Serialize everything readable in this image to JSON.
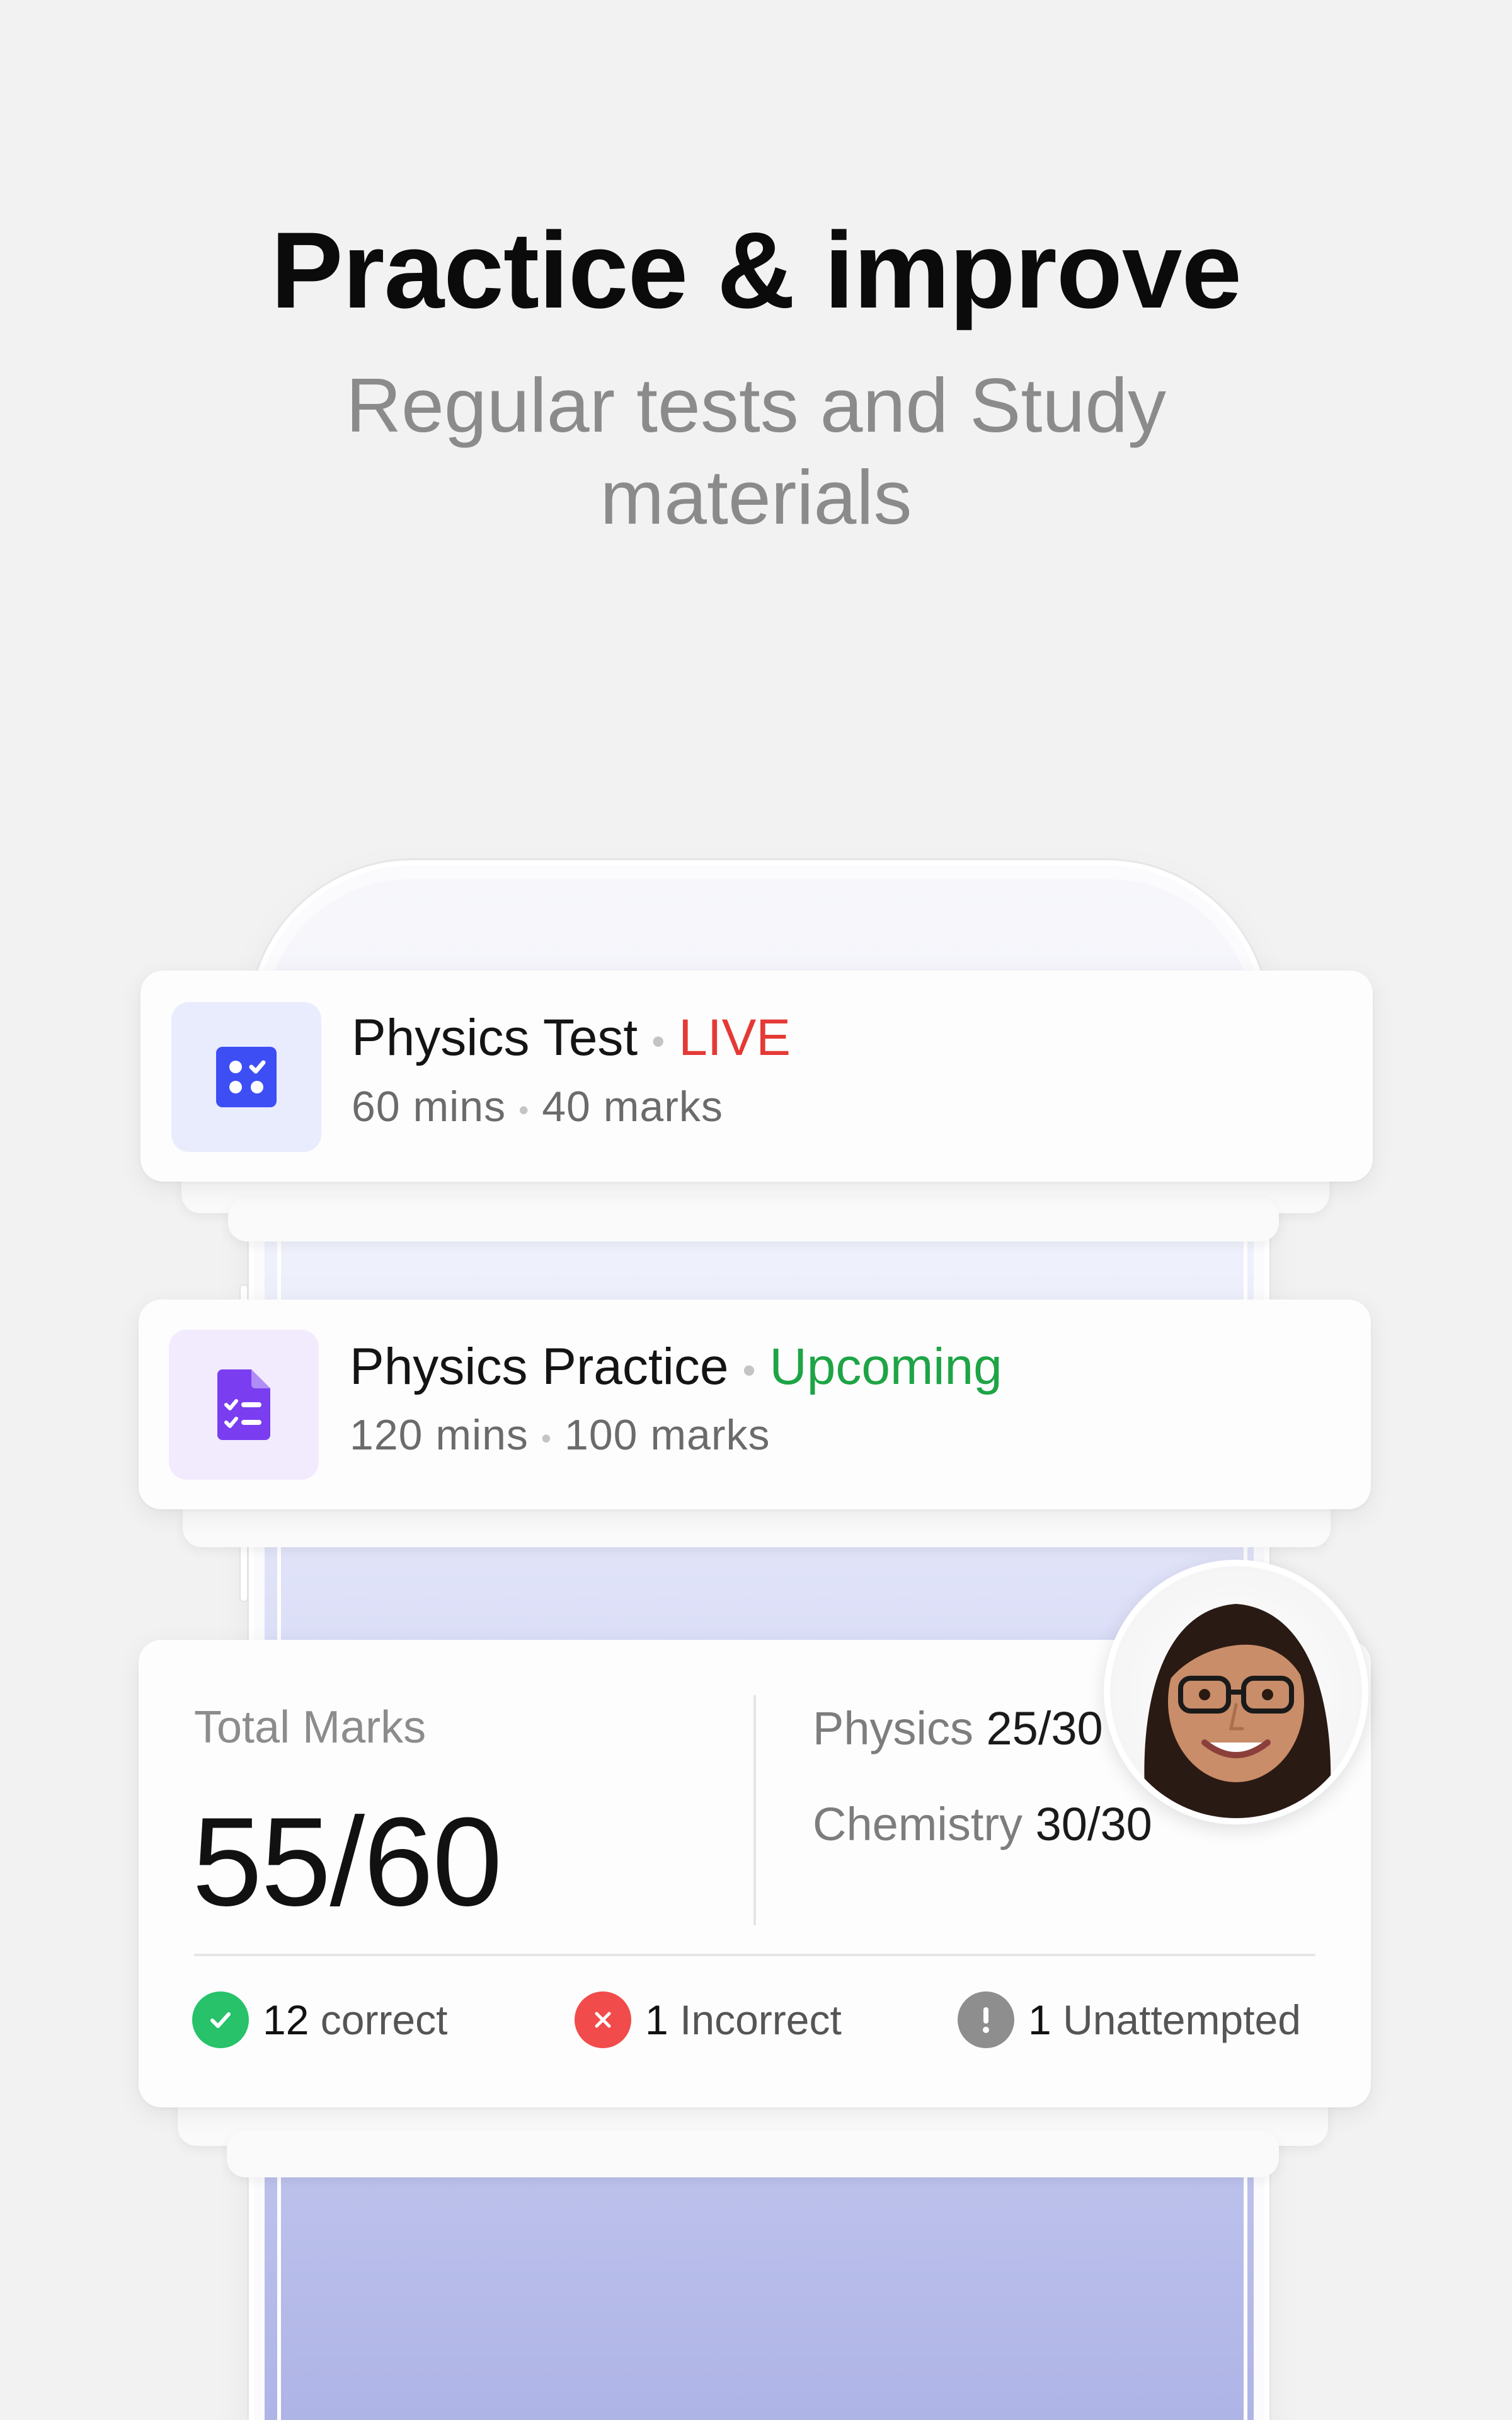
{
  "header": {
    "title": "Practice & improve",
    "subtitle": "Regular tests and Study materials"
  },
  "tests": [
    {
      "title": "Physics Test",
      "status": "LIVE",
      "duration": "60 mins",
      "marks": "40 marks",
      "icon": "quiz-grid-icon",
      "status_color": "#e53935"
    },
    {
      "title": "Physics Practice",
      "status": "Upcoming",
      "duration": "120 mins",
      "marks": "100 marks",
      "icon": "checklist-document-icon",
      "status_color": "#1ea446"
    }
  ],
  "results": {
    "total_label": "Total Marks",
    "total_value": "55/60",
    "subjects": [
      {
        "name": "Physics",
        "score": "25/30"
      },
      {
        "name": "Chemistry",
        "score": "30/30"
      }
    ],
    "stats": [
      {
        "count": "12",
        "label": "correct",
        "icon": "check-circle-icon",
        "color": "#27c26a"
      },
      {
        "count": "1",
        "label": "Incorrect",
        "icon": "x-circle-icon",
        "color": "#f14b4b"
      },
      {
        "count": "1",
        "label": "Unattempted",
        "icon": "exclamation-circle-icon",
        "color": "#8e8e8e"
      }
    ]
  },
  "colors": {
    "background": "#f2f2f2",
    "accent_blue": "#3d4ef5",
    "accent_purple": "#7a3df0"
  }
}
